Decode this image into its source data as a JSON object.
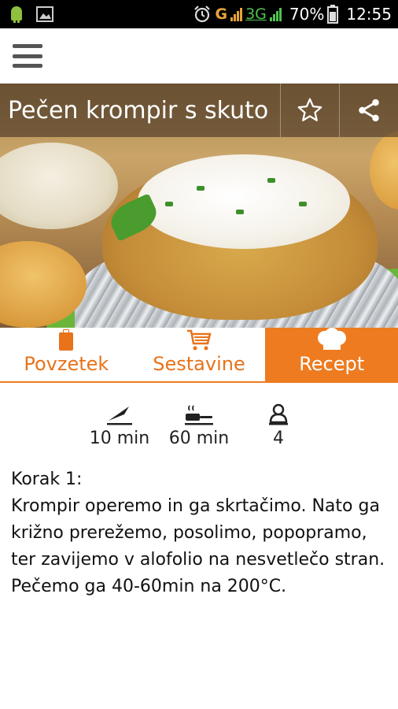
{
  "status_bar": {
    "network_g": "G",
    "network_3g": "3G",
    "battery": "70%",
    "time": "12:55",
    "icons": [
      "android-debug-icon",
      "image-icon",
      "alarm-icon",
      "signal-icon",
      "battery-icon"
    ]
  },
  "recipe": {
    "title": "Pečen krompir s skuto"
  },
  "tabs": [
    {
      "label": "Povzetek",
      "icon": "clipboard-icon",
      "active": false
    },
    {
      "label": "Sestavine",
      "icon": "cart-icon",
      "active": false
    },
    {
      "label": "Recept",
      "icon": "chef-hat-icon",
      "active": true
    }
  ],
  "meta": {
    "prep_time": "10 min",
    "cook_time": "60 min",
    "servings": "4"
  },
  "steps": {
    "step_label": "Korak 1:",
    "step_text": "Krompir operemo in ga skrtačimo. Nato ga križno prerežemo, posolimo, popopramo, ter zavijemo v alofolio na nesvetlečo stran. Pečemo ga 40-60min na 200°C."
  },
  "colors": {
    "accent": "#ee7b1f",
    "title_overlay": "#46322399"
  }
}
